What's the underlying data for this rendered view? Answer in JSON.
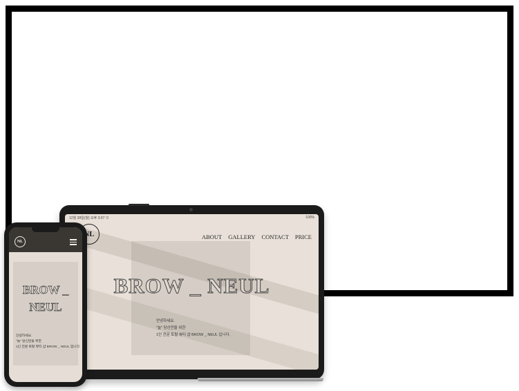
{
  "tablet": {
    "status_left": "12월 28일(월) 오후 3:07 ⊙",
    "status_right": "100%",
    "logo_text": "NL",
    "nav": [
      "ABOUT",
      "GALLERY",
      "CONTACT",
      "PRICE"
    ],
    "brand": "BROW _ NEUL",
    "intro": [
      "안녕하세요.",
      "\"늘\" 당신만을 위한",
      "1인 전문 토탈 뷰티 샵 BROW _ NEUL 입니다."
    ]
  },
  "phone": {
    "logo_text": "NL",
    "menu_icon": "hamburger-icon",
    "brand_line1": "BROW _",
    "brand_line2": "NEUL",
    "intro": [
      "안녕하세요.",
      "\"늘\" 당신만을 위한",
      "1인 전문 토탈 뷰티 샵 BROW _ NEUL 입니다."
    ]
  }
}
